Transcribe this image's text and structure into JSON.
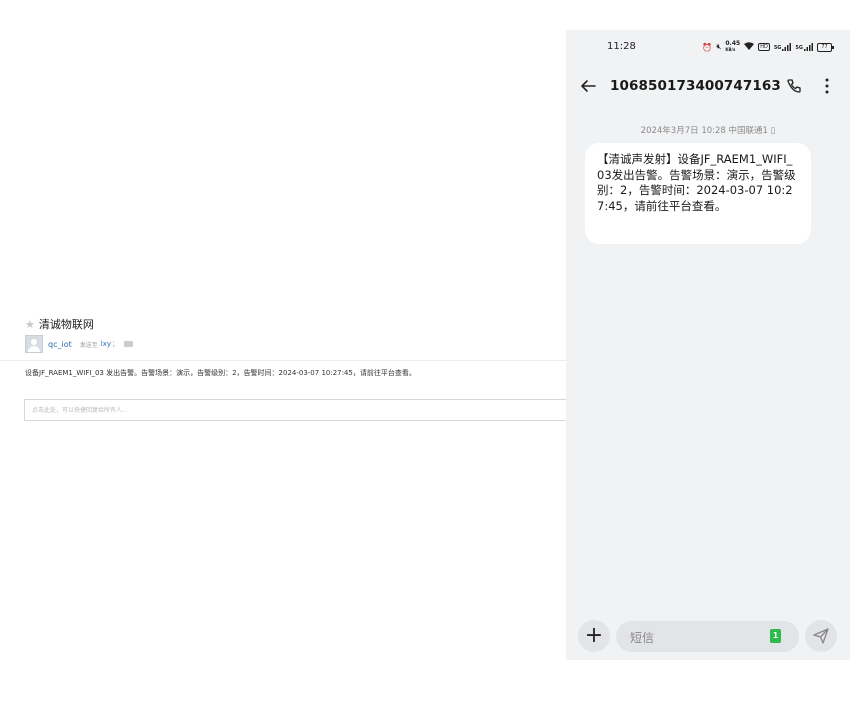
{
  "email": {
    "subject": "清诚物联网",
    "sender_name": "qc_iot",
    "to_label": "发送至",
    "recipient": "lxy",
    "recipient_sep": "；",
    "body": "设备JF_RAEM1_WIFI_03 发出告警。告警场景：演示，告警级别：2，告警时间：2024-03-07 10:27:45，请前往平台查看。",
    "reply_placeholder": "点击此处，可以快捷回复给所有人..."
  },
  "phone": {
    "time": "11:28",
    "status": {
      "speed_value": "0.45",
      "speed_unit": "KB/s",
      "hd_label": "HD",
      "signal1_label": "5G",
      "signal2_label": "5G",
      "battery": "77"
    },
    "contact": "106850173400747163",
    "message_meta": "2024年3月7日 10:28 中国联通1 ▯",
    "message": "【清诚声发射】设备JF_RAEM1_WIFI_03发出告警。告警场景：演示，告警级别：2，告警时间：2024-03-07 10:27:45，请前往平台查看。",
    "input_placeholder": "短信",
    "sim_badge": "1",
    "icons": {
      "back": "back-arrow-icon",
      "call": "phone-icon",
      "more": "more-vertical-icon",
      "add": "plus-icon",
      "send": "send-icon"
    },
    "colors": {
      "sim_badge": "#2dbb4d",
      "background": "#f1f2f4",
      "bubble": "#ffffff"
    }
  }
}
